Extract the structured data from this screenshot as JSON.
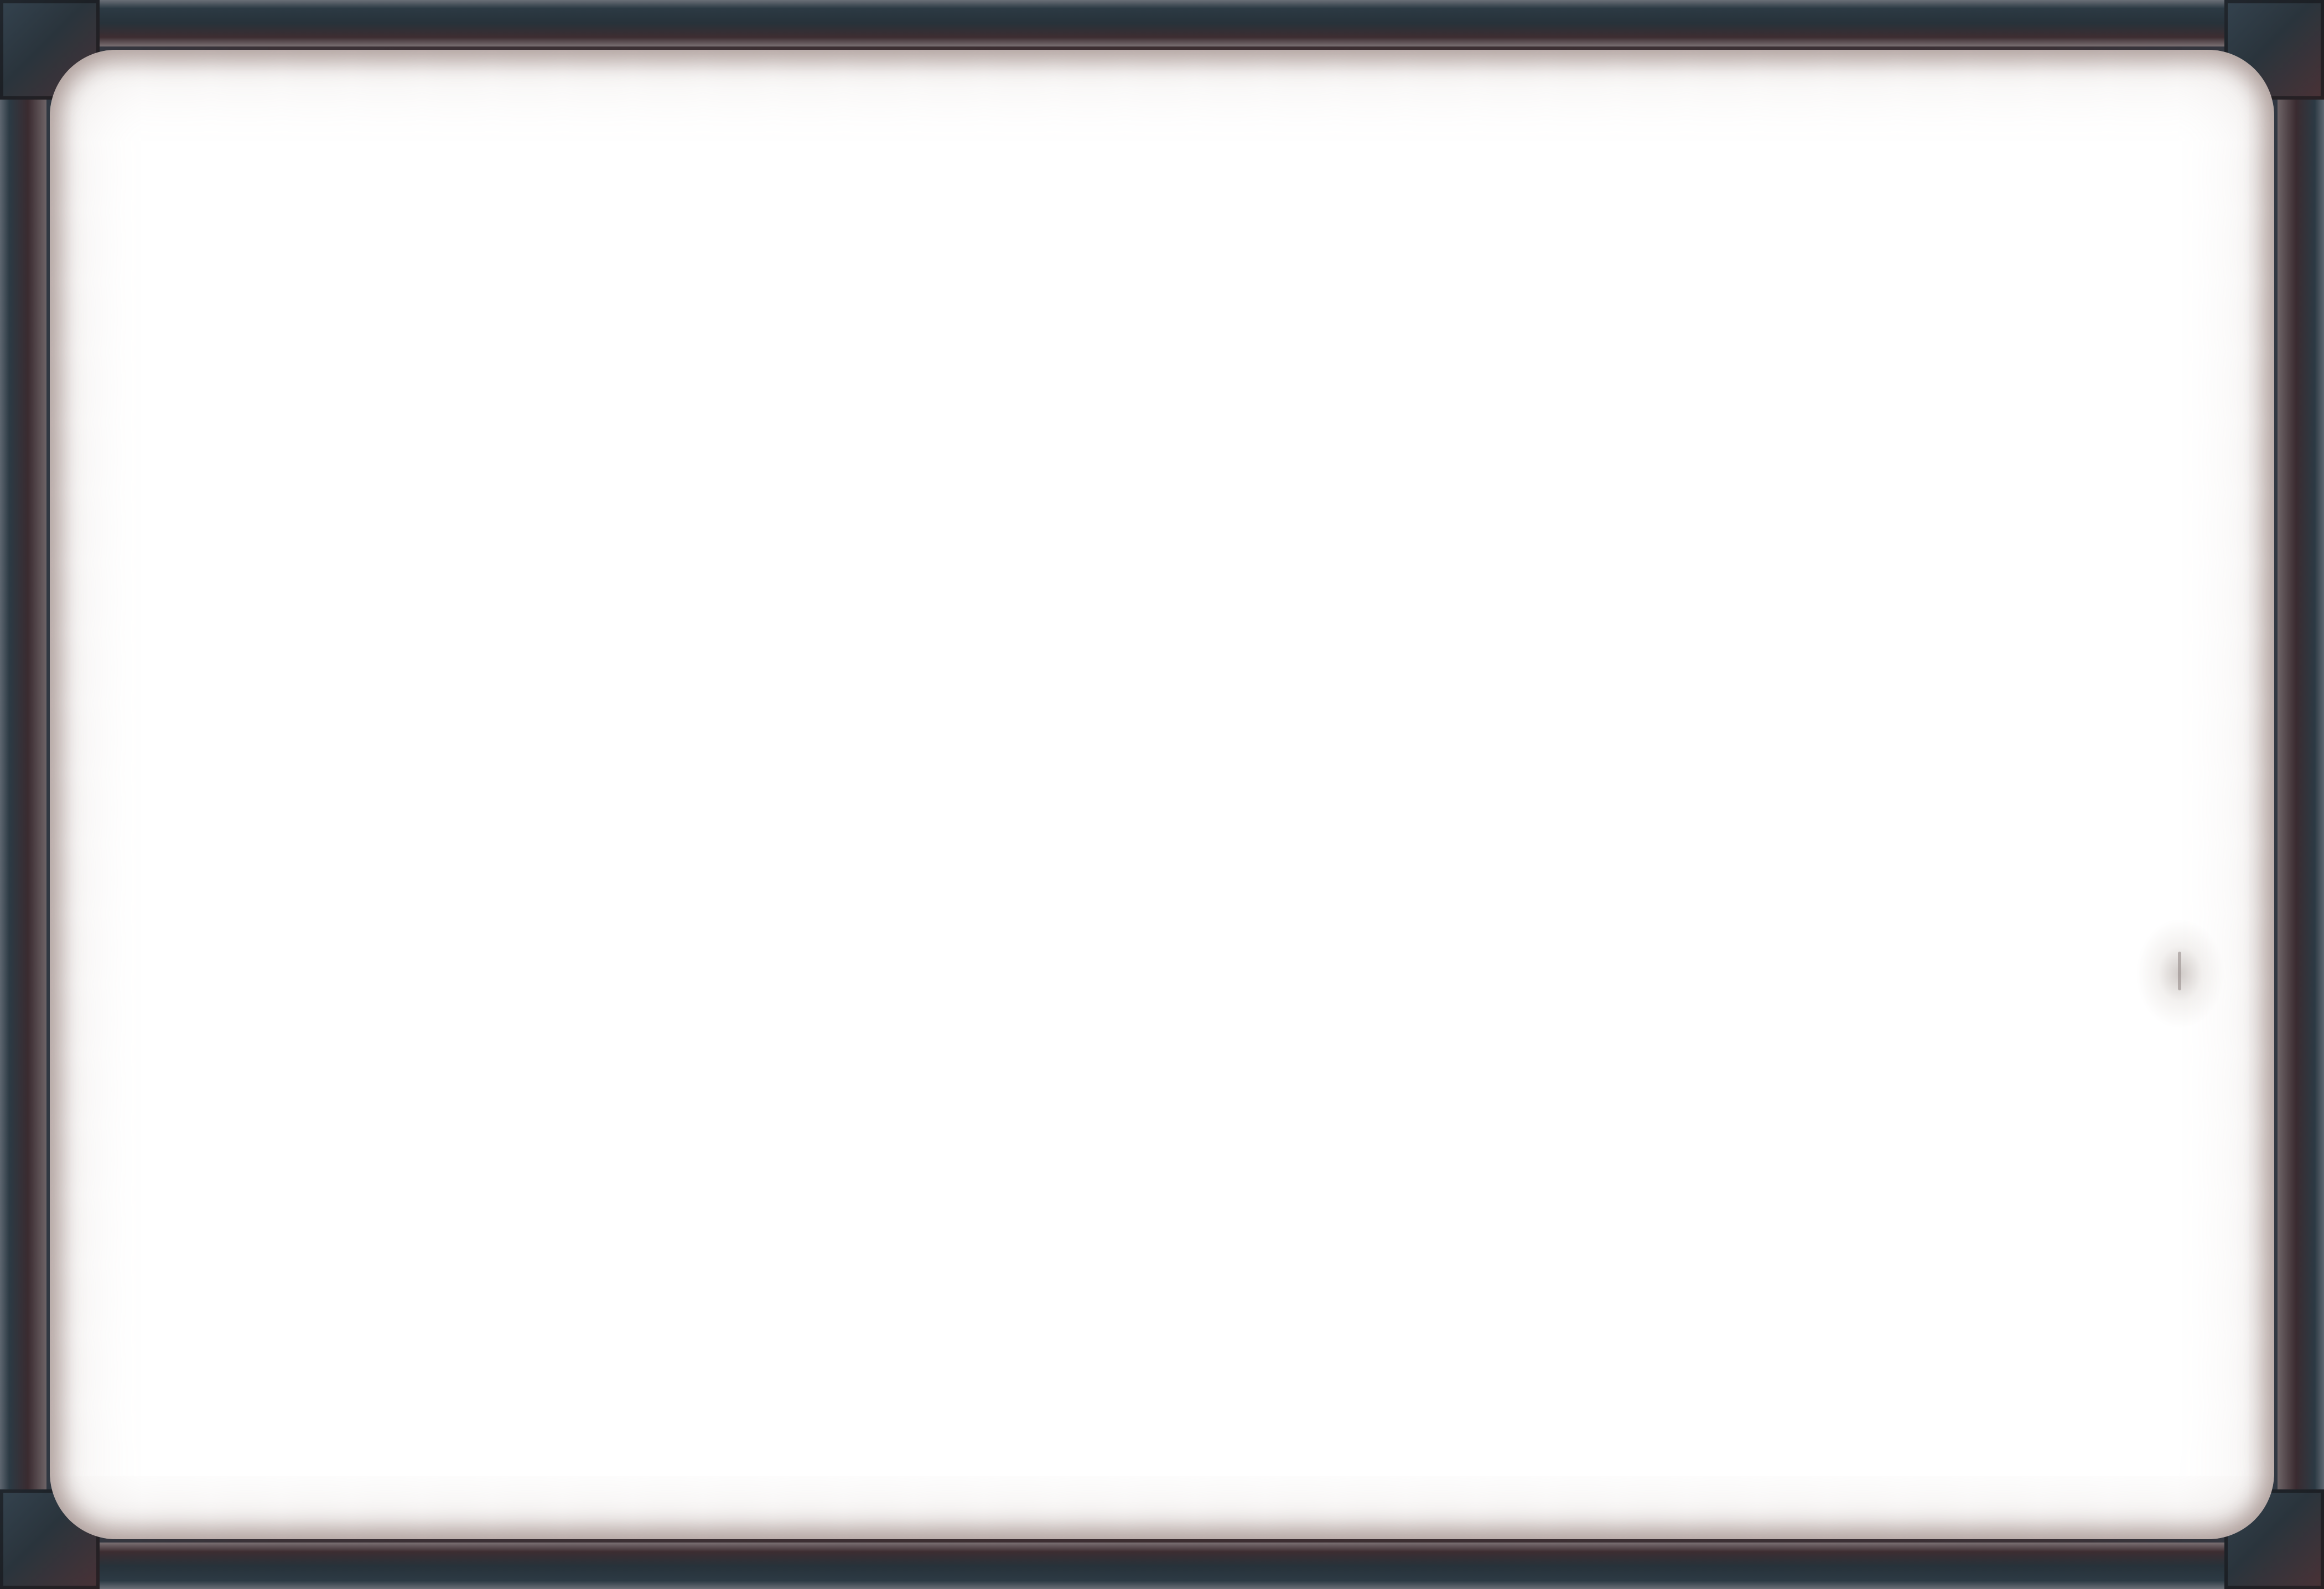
{
  "screen": {
    "type": "empty framed panel",
    "panel": {
      "content_text": ""
    }
  },
  "colors": {
    "frame_dark": "#2b2528",
    "frame_steel": "#2f3a45",
    "frame_maroon": "#3c2e31",
    "panel_fill": "#ffffff",
    "panel_shadow": "#785f5a"
  },
  "icons": {
    "side_handle": "drag-handle-icon"
  }
}
